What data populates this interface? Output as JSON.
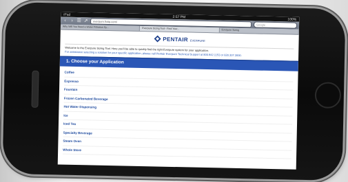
{
  "statusbar": {
    "carrier": "iPad",
    "time": "2:57 PM",
    "battery": "100%"
  },
  "browser": {
    "address": "everpure.fixtip.com/",
    "search_placeholder": "Google",
    "tabs": [
      {
        "label": "Why Will You Need a Water Filtration Sy..."
      },
      {
        "label": "Everpure Sizing Tool - Find Your..."
      },
      {
        "label": "Everpure Sizing"
      }
    ]
  },
  "header": {
    "brand": "PENTAIR",
    "sub": "EVERPURE"
  },
  "intro": {
    "welcome": "Welcome to the Everpure Sizing Tool. Here you'll be able to quickly find the right Everpure system for your application.",
    "assistance": "For assistance selecting a solution for your specific application, please call Pentair Everpure Technical Support at 800.942.1153 or 630.307.3000."
  },
  "section": {
    "title": "1. Choose your Application"
  },
  "applications": [
    {
      "label": "Coffee"
    },
    {
      "label": "Espresso"
    },
    {
      "label": "Fountain"
    },
    {
      "label": "Frozen Carbonated Beverage"
    },
    {
      "label": "Hot Water Dispensing"
    },
    {
      "label": "Ice"
    },
    {
      "label": "Iced Tea"
    },
    {
      "label": "Specialty Beverage"
    },
    {
      "label": "Steam Oven"
    },
    {
      "label": "Whole Store"
    }
  ],
  "colors": {
    "brand": "#1d3f8c",
    "header_bar": "#2a56b6",
    "link": "#1e4a9e"
  }
}
